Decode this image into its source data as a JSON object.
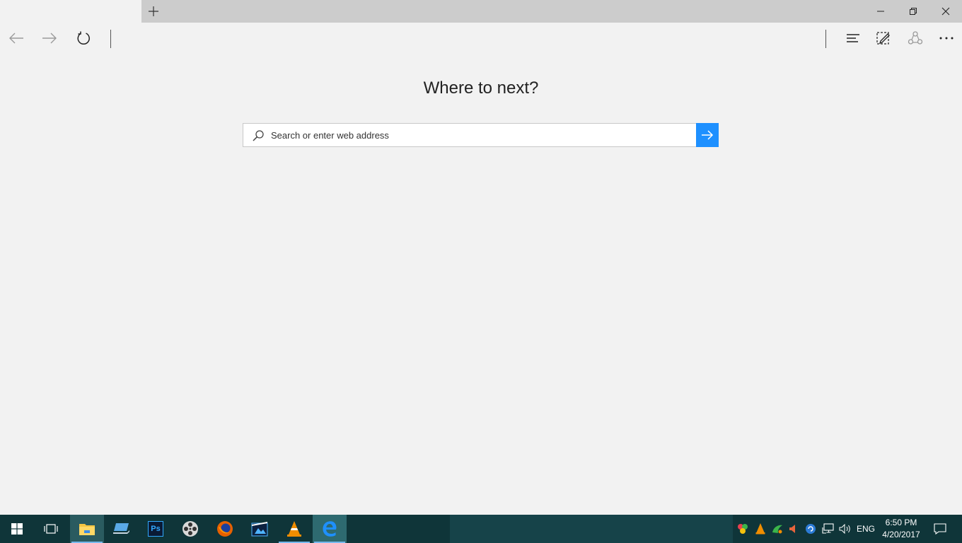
{
  "browser": {
    "new_tab_label": "New tab",
    "window_controls": [
      "minimize-icon",
      "restore-icon",
      "close-icon"
    ],
    "toolbar_icons": [
      "back-arrow-icon",
      "forward-arrow-icon",
      "refresh-icon",
      "hub-icon",
      "web-note-icon",
      "share-icon",
      "more-icon"
    ]
  },
  "main": {
    "title": "Where to next?",
    "search_placeholder": "Search or enter web address"
  },
  "taskbar": {
    "apps": [
      "start-icon",
      "task-view-icon",
      "file-explorer-icon",
      "laptop-icon",
      "photoshop-icon",
      "film-reel-icon",
      "firefox-icon",
      "video-editor-icon",
      "vlc-icon",
      "edge-icon"
    ],
    "photoshop_label": "Ps",
    "tray": {
      "language": "ENG",
      "time": "6:50 PM",
      "date": "4/20/2017"
    }
  },
  "colors": {
    "accent": "#1e90ff",
    "taskbar": "#0f3539",
    "page_bg": "#f2f2f2",
    "tabbar_bg": "#cccccc"
  }
}
